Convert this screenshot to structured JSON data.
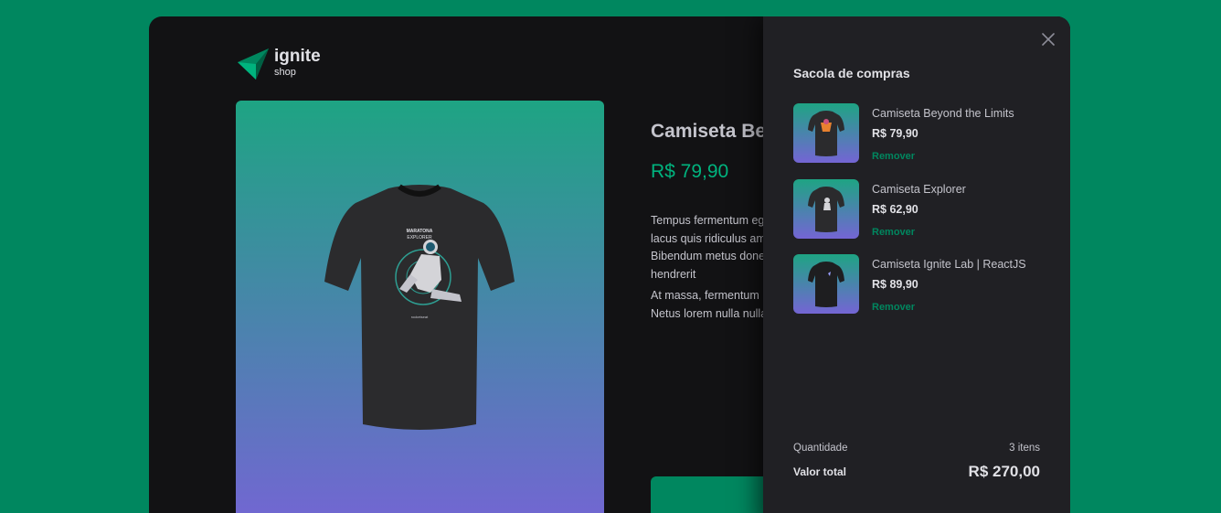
{
  "brand": {
    "name": "ignite",
    "sub": "shop",
    "accent": "#00875f"
  },
  "product": {
    "title": "Camiseta Beyond the Limits",
    "price": "R$ 79,90",
    "description_1": "Tempus fermentum eget lacus quis ridiculus amet. Bibendum metus donec hendrerit",
    "description_2": "At massa, fermentum Netus lorem nulla nulla"
  },
  "cart": {
    "title": "Sacola de compras",
    "items": [
      {
        "name": "Camiseta Beyond the Limits",
        "price": "R$ 79,90",
        "remove_label": "Remover"
      },
      {
        "name": "Camiseta Explorer",
        "price": "R$ 62,90",
        "remove_label": "Remover"
      },
      {
        "name": "Camiseta Ignite Lab | ReactJS",
        "price": "R$ 89,90",
        "remove_label": "Remover"
      }
    ],
    "quantity_label": "Quantidade",
    "quantity_value": "3 itens",
    "total_label": "Valor total",
    "total_value": "R$ 270,00"
  },
  "icons": {
    "close": "close-icon",
    "logo": "ignite-logo-icon"
  }
}
